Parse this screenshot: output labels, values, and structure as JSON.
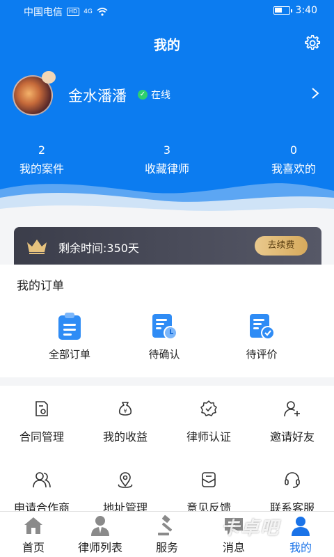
{
  "status_bar": {
    "carrier": "中国电信",
    "hd": "HD",
    "signal": "4G",
    "time": "3:40",
    "battery_level": 0.5
  },
  "header": {
    "title": "我的"
  },
  "profile": {
    "username": "金水潘潘",
    "status": "在线"
  },
  "stats": [
    {
      "value": "2",
      "label": "我的案件"
    },
    {
      "value": "3",
      "label": "收藏律师"
    },
    {
      "value": "0",
      "label": "我喜欢的"
    }
  ],
  "vip": {
    "remaining": "剩余时间:350天",
    "renew_label": "去续费"
  },
  "orders": {
    "title": "我的订单",
    "items": [
      {
        "label": "全部订单",
        "icon": "clipboard-icon"
      },
      {
        "label": "待确认",
        "icon": "clock-doc-icon"
      },
      {
        "label": "待评价",
        "icon": "check-doc-icon"
      }
    ]
  },
  "tools": [
    {
      "label": "合同管理",
      "icon": "contract-icon"
    },
    {
      "label": "我的收益",
      "icon": "money-bag-icon"
    },
    {
      "label": "律师认证",
      "icon": "badge-check-icon"
    },
    {
      "label": "邀请好友",
      "icon": "add-user-icon"
    },
    {
      "label": "申请合作商",
      "icon": "partners-icon"
    },
    {
      "label": "地址管理",
      "icon": "location-icon"
    },
    {
      "label": "意见反馈",
      "icon": "feedback-icon"
    },
    {
      "label": "联系客服",
      "icon": "headset-icon"
    }
  ],
  "tabbar": [
    {
      "label": "首页",
      "icon": "home-icon"
    },
    {
      "label": "律师列表",
      "icon": "lawyer-icon"
    },
    {
      "label": "服务",
      "icon": "gavel-icon"
    },
    {
      "label": "消息",
      "icon": "message-icon"
    },
    {
      "label": "我的",
      "icon": "user-icon",
      "active": true
    }
  ],
  "watermark": "卡卓吧",
  "colors": {
    "primary": "#0c7cf0",
    "online": "#2ed06e",
    "vip_gold": "#e9c98d",
    "active_tab": "#1a73e8"
  }
}
